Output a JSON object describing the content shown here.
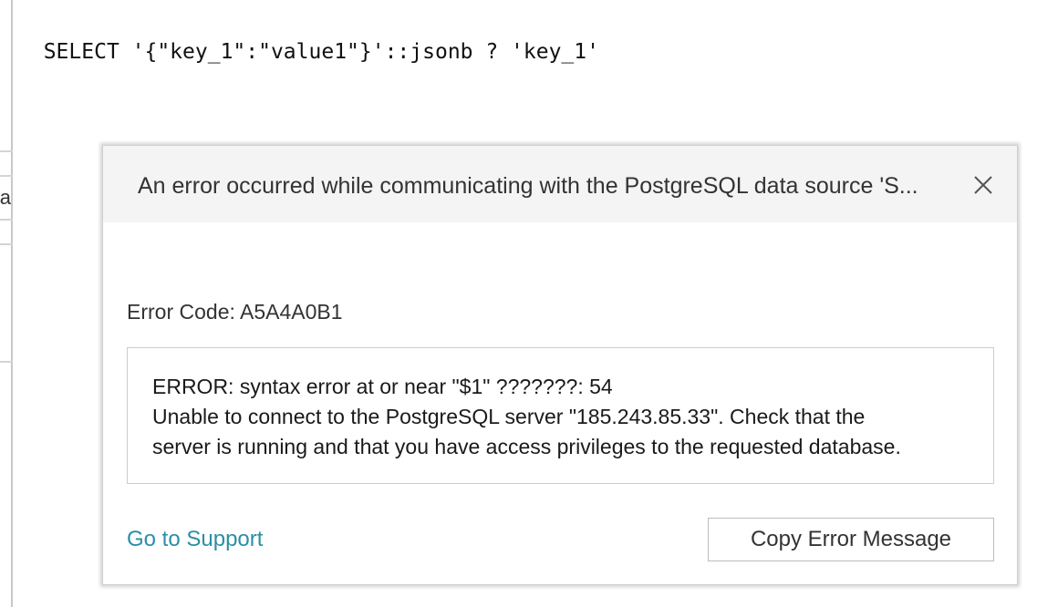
{
  "editor": {
    "query": "SELECT '{\"key_1\":\"value1\"}'::jsonb ? 'key_1'"
  },
  "gutter": {
    "tab_label": "Da"
  },
  "dialog": {
    "title": "An error occurred while communicating with the PostgreSQL data source 'S...",
    "close_icon": "close-icon",
    "error_code_label": "Error Code: A5A4A0B1",
    "message_lines": [
      "ERROR: syntax error at or near \"$1\" ???????: 54",
      "Unable to connect to the PostgreSQL server \"185.243.85.33\". Check that the",
      "server is running and that you have access privileges to the requested database."
    ],
    "support_link": "Go to Support",
    "copy_button": "Copy Error Message"
  },
  "colors": {
    "link": "#2a8fa6",
    "header_bg": "#f4f4f4",
    "border": "#cccccc"
  }
}
